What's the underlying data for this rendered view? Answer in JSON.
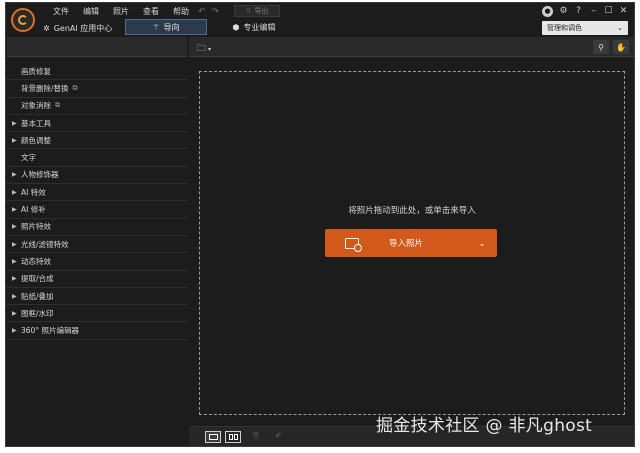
{
  "menu": {
    "items": [
      "文件",
      "编辑",
      "照片",
      "查看",
      "帮助"
    ]
  },
  "toolbar": {
    "undo_icon": "undo-icon",
    "redo_icon": "redo-icon",
    "export_label": "导出"
  },
  "window_controls": {
    "icons": [
      "user-icon",
      "settings-icon",
      "help-icon",
      "minimize-icon",
      "maximize-icon",
      "close-icon"
    ]
  },
  "mode_bar": {
    "genai_label": "GenAI 应用中心",
    "guided_label": "导向",
    "pro_label": "专业编辑",
    "workspace_label": "管理和调色"
  },
  "sidebar": {
    "items": [
      {
        "label": "画质修复",
        "expandable": false,
        "external": false
      },
      {
        "label": "背景删除/替换",
        "expandable": false,
        "external": true
      },
      {
        "label": "对象消除",
        "expandable": false,
        "external": true
      },
      {
        "label": "基本工具",
        "expandable": true,
        "external": false
      },
      {
        "label": "颜色调整",
        "expandable": true,
        "external": false
      },
      {
        "label": "文字",
        "expandable": false,
        "external": false
      },
      {
        "label": "人物修饰器",
        "expandable": true,
        "external": false
      },
      {
        "label": "AI 特效",
        "expandable": true,
        "external": false
      },
      {
        "label": "AI 修补",
        "expandable": true,
        "external": false
      },
      {
        "label": "照片特效",
        "expandable": true,
        "external": false
      },
      {
        "label": "光线/滤镜特效",
        "expandable": true,
        "external": false
      },
      {
        "label": "动态特效",
        "expandable": true,
        "external": false
      },
      {
        "label": "提取/合成",
        "expandable": true,
        "external": false
      },
      {
        "label": "贴纸/叠加",
        "expandable": true,
        "external": false
      },
      {
        "label": "图框/水印",
        "expandable": true,
        "external": false
      },
      {
        "label": "360° 照片编辑器",
        "expandable": true,
        "external": false
      }
    ]
  },
  "canvas": {
    "drop_hint": "将照片拖动到此处，或单击来导入",
    "import_button_label": "导入照片"
  },
  "watermark": "掘金技术社区 @ 非凡ghost",
  "colors": {
    "accent": "#d2591a",
    "background": "#1c1c1c",
    "panel": "#2a2a2a"
  }
}
